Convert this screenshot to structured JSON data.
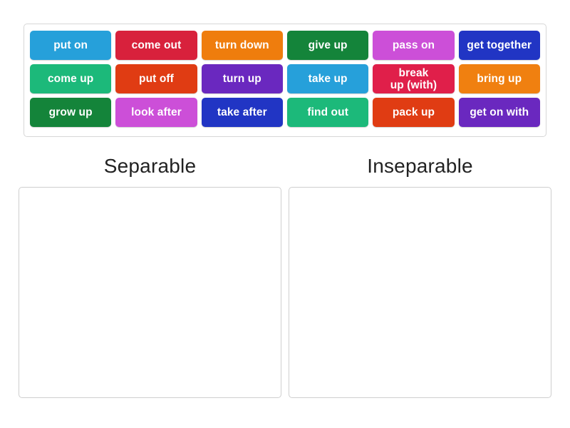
{
  "activity": {
    "type": "group-sort",
    "tile_text_color": "#ffffff",
    "tray_border_color": "#d7d7d7",
    "zone_border_color": "#cfcfcf",
    "heading_color": "#222222",
    "background": "#ffffff"
  },
  "tray": {
    "rows": [
      [
        {
          "label": "put on",
          "color": "#26a0da"
        },
        {
          "label": "come out",
          "color": "#d8213c"
        },
        {
          "label": "turn down",
          "color": "#ef7d0d"
        },
        {
          "label": "give up",
          "color": "#14843a"
        },
        {
          "label": "pass on",
          "color": "#cc4fd8"
        },
        {
          "label": "get together",
          "color": "#2135c4"
        }
      ],
      [
        {
          "label": "come up",
          "color": "#1cb97a"
        },
        {
          "label": "put off",
          "color": "#e03c13"
        },
        {
          "label": "turn up",
          "color": "#6a28bf"
        },
        {
          "label": "take up",
          "color": "#26a0da"
        },
        {
          "label": "break\nup (with)",
          "color": "#e01f4a"
        },
        {
          "label": "bring up",
          "color": "#f08010"
        }
      ],
      [
        {
          "label": "grow up",
          "color": "#14843a"
        },
        {
          "label": "look after",
          "color": "#cc4fd8"
        },
        {
          "label": "take after",
          "color": "#2135c4"
        },
        {
          "label": "find out",
          "color": "#1cb97a"
        },
        {
          "label": "pack up",
          "color": "#e03c13"
        },
        {
          "label": "get on with",
          "color": "#6a28bf"
        }
      ]
    ]
  },
  "categories": [
    {
      "heading": "Separable",
      "items": []
    },
    {
      "heading": "Inseparable",
      "items": []
    }
  ]
}
